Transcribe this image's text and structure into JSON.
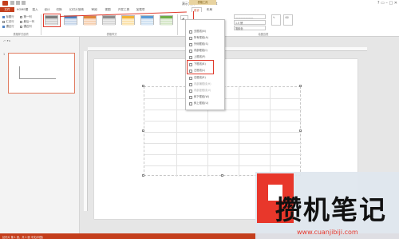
{
  "window": {
    "title": "演示文稿1 - PowerPoint",
    "context_tab_group": "表格工具",
    "controls": "?  ▭  –  □  ✕"
  },
  "tabs": [
    {
      "label": "文件"
    },
    {
      "label": "HOME模"
    },
    {
      "label": "插入"
    },
    {
      "label": "设计"
    },
    {
      "label": "切换"
    },
    {
      "label": "幻灯片放映"
    },
    {
      "label": "审阅"
    },
    {
      "label": "视图"
    },
    {
      "label": "开发工具"
    },
    {
      "label": "加载项"
    },
    {
      "label": "设计"
    },
    {
      "label": "布局"
    }
  ],
  "ribbon": {
    "style_options": {
      "left_col": [
        "标题行",
        "汇总行",
        "镶边行"
      ],
      "right_col": [
        "第一列",
        "最后一列",
        "镶边列"
      ],
      "group_label": "表格样式选项"
    },
    "table_styles_group_label": "表格样式",
    "draw_borders_group_label": "绘图边框",
    "pen_weight": "1.0 磅",
    "pen_color_label": "笔颜色"
  },
  "border_menu": {
    "button_label": "边框",
    "items": [
      {
        "label": "无框线(N)",
        "disabled": false
      },
      {
        "label": "所有框线(A)",
        "disabled": false
      },
      {
        "label": "外侧框线(S)",
        "disabled": false
      },
      {
        "label": "内部框线(I)",
        "disabled": false
      },
      {
        "label": "上框线(P)",
        "disabled": false
      },
      {
        "label": "下框线(B)",
        "disabled": false
      },
      {
        "label": "左框线(L)",
        "disabled": false
      },
      {
        "label": "右框线(R)",
        "disabled": false
      },
      {
        "label": "内部横框线(H)",
        "disabled": true
      },
      {
        "label": "内部竖框线(V)",
        "disabled": true
      },
      {
        "label": "斜下框线(W)",
        "disabled": false
      },
      {
        "label": "斜上框线(U)",
        "disabled": false
      }
    ]
  },
  "slides_panel": {
    "slide_number": "1"
  },
  "status": {
    "text": "幻灯片 第 1 张，共 1 张    中文(中国)"
  },
  "watermark": {
    "title": "攒机笔记",
    "url": "www.cuanjibiji.com"
  },
  "colors": {
    "accent": "#c43e1c",
    "highlight": "#e03a2c"
  }
}
